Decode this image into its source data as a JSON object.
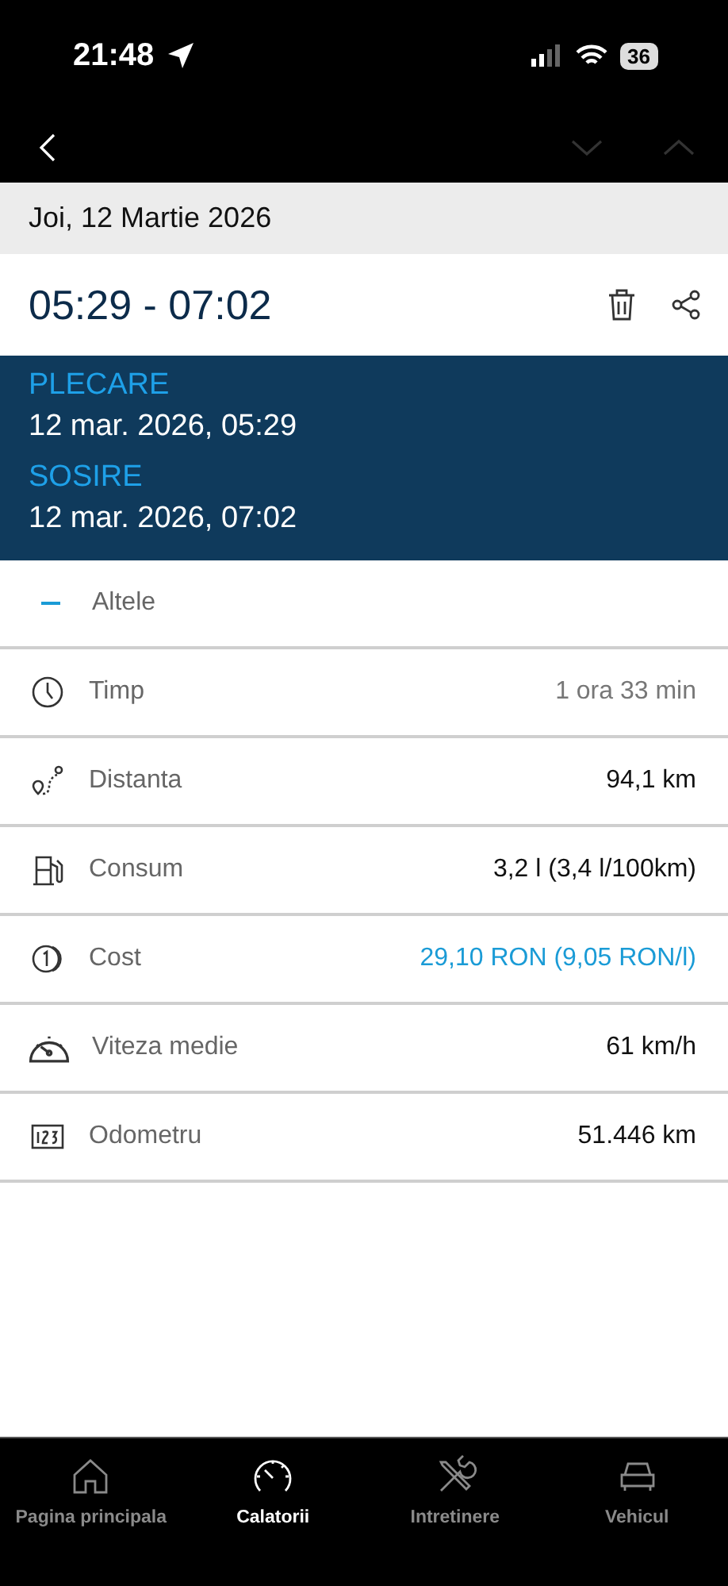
{
  "status_bar": {
    "time": "21:48",
    "battery": "36"
  },
  "nav": {
    "down_disabled": true,
    "up_disabled": true
  },
  "date_header": "Joi, 12 Martie 2026",
  "trip": {
    "range": "05:29 - 07:02"
  },
  "departure": {
    "label": "PLECARE",
    "value": "12 mar. 2026, 05:29"
  },
  "arrival": {
    "label": "SOSIRE",
    "value": "12 mar. 2026, 07:02"
  },
  "category": {
    "label": "Altele"
  },
  "rows": [
    {
      "kind": "clock",
      "label": "Timp",
      "value": "1 ora 33 min",
      "color": "#777777"
    },
    {
      "kind": "route",
      "label": "Distanta",
      "value": "94,1 km",
      "color": "#111111"
    },
    {
      "kind": "fuel",
      "label": "Consum",
      "value": "3,2 l (3,4 l/100km)",
      "color": "#111111"
    },
    {
      "kind": "coin",
      "label": "Cost",
      "value": "29,10 RON (9,05 RON/l)",
      "color": "#1a9bd6"
    },
    {
      "kind": "speed",
      "label": "Viteza medie",
      "value": "61 km/h",
      "color": "#111111"
    },
    {
      "kind": "counter",
      "label": "Odometru",
      "value": "51.446 km",
      "color": "#111111"
    }
  ],
  "tabs": [
    {
      "kind": "home",
      "label": "Pagina principala",
      "selected": false
    },
    {
      "kind": "gauge",
      "label": "Calatorii",
      "selected": true
    },
    {
      "kind": "tools",
      "label": "Intretinere",
      "selected": false
    },
    {
      "kind": "car",
      "label": "Vehicul",
      "selected": false
    }
  ]
}
